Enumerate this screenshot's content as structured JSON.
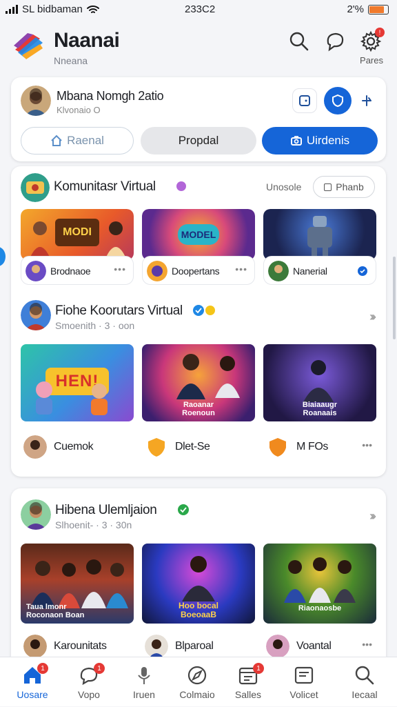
{
  "status_bar": {
    "carrier": "SL bidbaman",
    "time": "233C2",
    "battery": "2'%"
  },
  "header": {
    "app_name": "Naanai",
    "subtitle": "Nneana",
    "icons": [
      "search-icon",
      "chat-icon",
      "settings-icon"
    ],
    "settings_label": "Pares"
  },
  "profile": {
    "name": "Mbana Nomgh 2atio",
    "subtitle": "Klvonaio O",
    "tabs": [
      "Raenal",
      "Propdal",
      "Uirdenis"
    ],
    "active_tab": 2
  },
  "section1": {
    "title": "Komunitasr Virtual",
    "action_text": "Unosole",
    "action_button": "Phanb",
    "tiles": [
      {
        "label": "Brodnaoe",
        "banner": "MODI"
      },
      {
        "label": "Doopertans",
        "banner": "MODEL"
      },
      {
        "label": "Nanerial",
        "banner": ""
      }
    ]
  },
  "section2": {
    "title": "Fiohe Koorutars Virtual",
    "subtitle": "Smoenith · 3 · oon",
    "images": [
      {
        "caption": "HEN!"
      },
      {
        "caption": "Raoanar\nRoenoun"
      },
      {
        "caption": "Biaiaaugr\nRoanaais"
      }
    ],
    "row": [
      {
        "label": "Cuemok"
      },
      {
        "label": "Dlet-Se"
      },
      {
        "label": "M FOs"
      }
    ]
  },
  "section3": {
    "title": "Hibena Ulemljaion",
    "subtitle": "Slhoenit- · 3 · 30n",
    "images": [
      {
        "caption": "Taua lmonr\nRoconaon Boan"
      },
      {
        "caption": "Hoo bocal\nBoeoaaB"
      },
      {
        "caption": "Riaonaosbe"
      }
    ],
    "row": [
      {
        "label": "Karounitats"
      },
      {
        "label": "Blparoal"
      },
      {
        "label": "Voantal"
      }
    ]
  },
  "bottom_nav": [
    {
      "label": "Uosare",
      "icon": "home-icon",
      "badge": "1"
    },
    {
      "label": "Vopo",
      "icon": "chat-bubble-icon",
      "badge": "1"
    },
    {
      "label": "Iruen",
      "icon": "microphone-icon",
      "badge": ""
    },
    {
      "label": "Colmaio",
      "icon": "compass-icon",
      "badge": ""
    },
    {
      "label": "Salles",
      "icon": "calendar-icon",
      "badge": "1"
    },
    {
      "label": "Volicet",
      "icon": "message-box-icon",
      "badge": ""
    },
    {
      "label": "Iecaal",
      "icon": "search-icon",
      "badge": ""
    }
  ],
  "colors": {
    "accent": "#1565d8",
    "badge": "#e53935",
    "verified": "#2aa84a"
  }
}
